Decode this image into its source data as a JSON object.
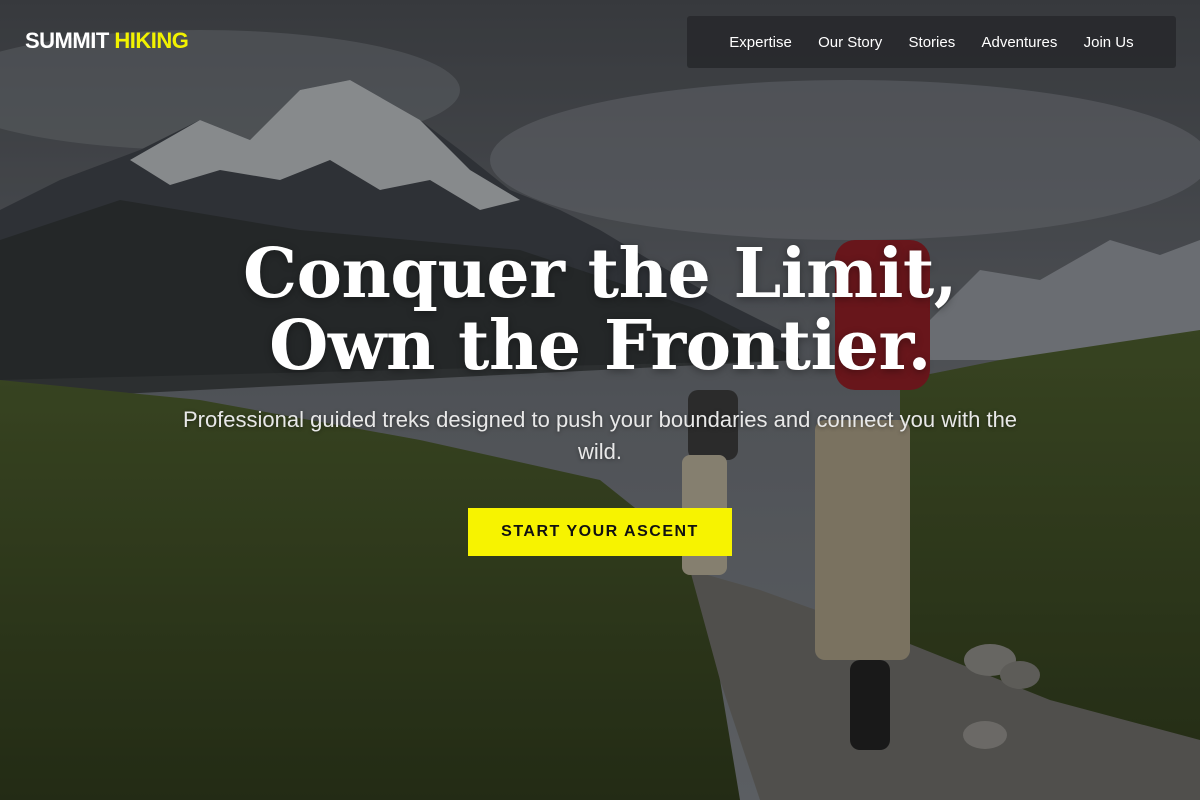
{
  "brand": {
    "name_part1": "SUMMIT",
    "name_part2": "HIKING"
  },
  "nav": {
    "items": [
      {
        "label": "Expertise"
      },
      {
        "label": "Our Story"
      },
      {
        "label": "Stories"
      },
      {
        "label": "Adventures"
      },
      {
        "label": "Join Us"
      }
    ]
  },
  "hero": {
    "headline_line1": "Conquer the Limit,",
    "headline_line2": "Own the Frontier.",
    "subtext": "Professional guided treks designed to push your boundaries and connect you with the wild.",
    "cta_label": "START YOUR ASCENT",
    "background_image": "mountain-hikers-photo"
  },
  "colors": {
    "accent": "#F5F300",
    "nav_background": "#2B2C2F",
    "text": "#FFFFFF"
  }
}
